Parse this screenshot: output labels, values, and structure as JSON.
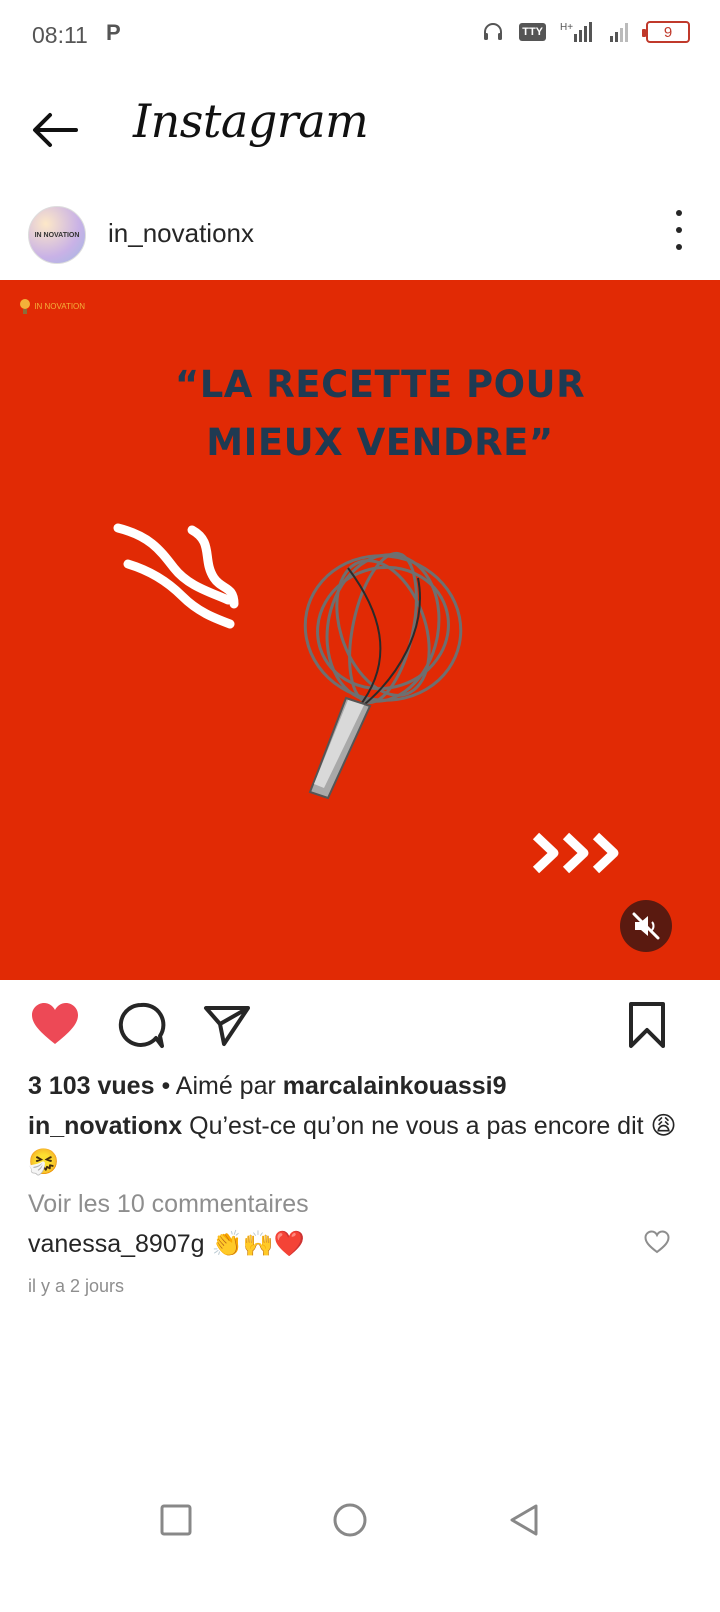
{
  "status_bar": {
    "time": "08:11",
    "indicator": "P",
    "tty": "TTY",
    "battery": "9"
  },
  "header": {
    "app_title": "Instagram"
  },
  "post": {
    "username": "in_novationx",
    "avatar_text": "IN NOVATION",
    "media": {
      "logo_text": "IN NOVATION",
      "title_line1": "“LA RECETTE POUR",
      "title_line2": "MIEUX VENDRE”",
      "background_color": "#e12a05",
      "title_color": "#1f3a52"
    },
    "views_count": "3 103 vues",
    "liked_by_prefix": " • Aimé par ",
    "liked_by_user": "marcalainkouassi9",
    "caption_user": "in_novationx",
    "caption_text": " Qu’est-ce qu’on ne vous a pas encore dit 😩🤧",
    "view_comments": "Voir les 10 commentaires",
    "comment_user": "vanessa_8907g",
    "comment_text": " 👏🙌❤️",
    "time_ago": "il y a 2 jours",
    "liked": true,
    "like_color": "#ed4956"
  }
}
